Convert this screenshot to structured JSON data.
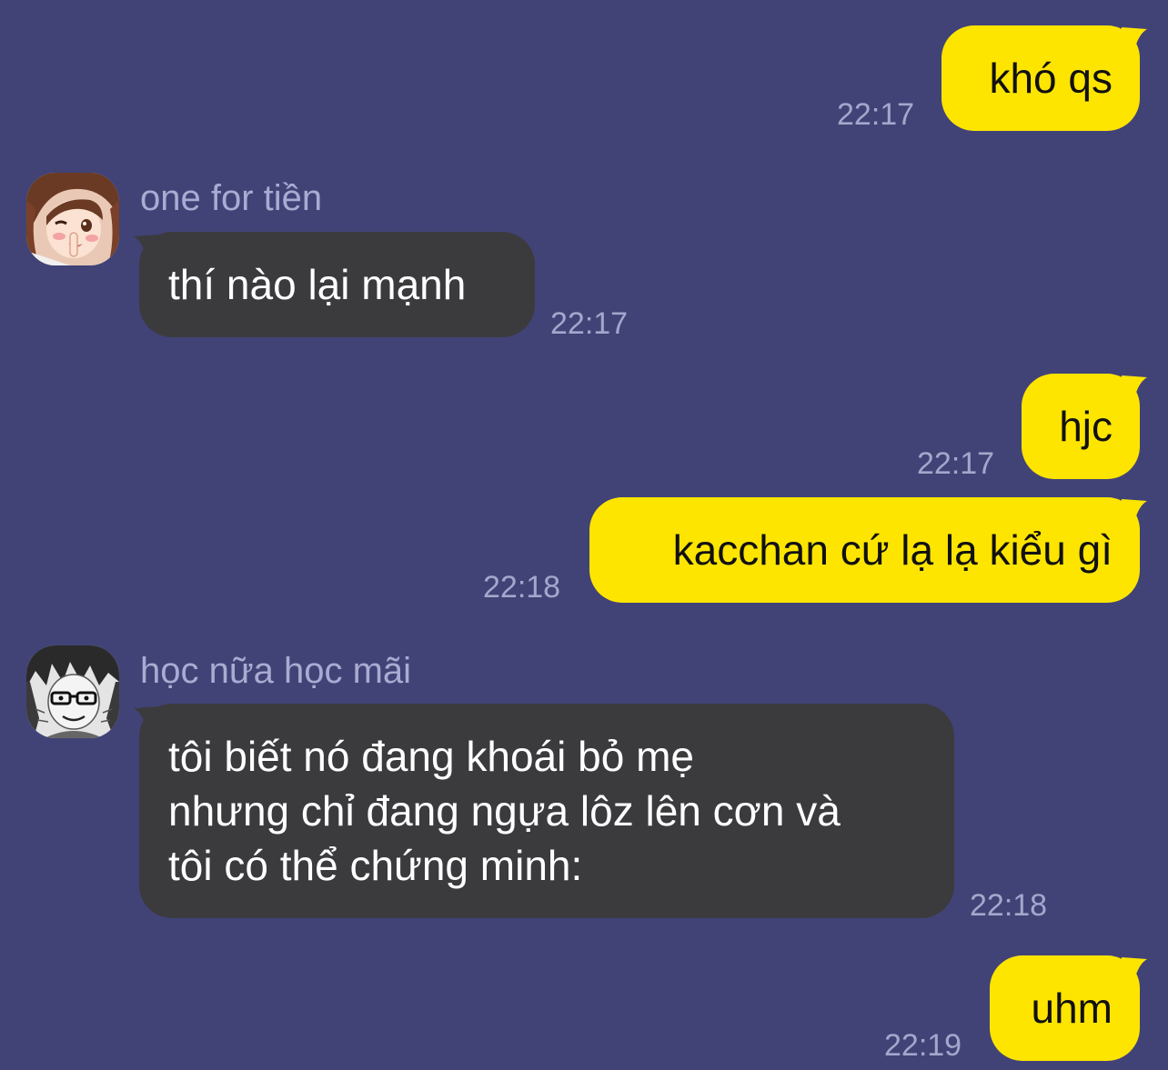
{
  "messages": [
    {
      "direction": "out",
      "text": "khó qs",
      "time": "22:17"
    },
    {
      "direction": "in",
      "sender": "one for tiền",
      "avatar": "anime-girl-avatar",
      "text": "thí nào lại mạnh",
      "time": "22:17"
    },
    {
      "direction": "out",
      "text": "hjc",
      "time": "22:17"
    },
    {
      "direction": "out",
      "text": "kacchan cứ lạ lạ kiểu gì",
      "time": "22:18"
    },
    {
      "direction": "in",
      "sender": "học nữa học mãi",
      "avatar": "manga-character-avatar",
      "lines": [
        "tôi biết nó đang khoái bỏ mẹ",
        "nhưng chỉ đang ngựa lôz lên cơn và",
        "tôi có thể chứng minh:"
      ],
      "time": "22:18"
    },
    {
      "direction": "out",
      "text": "uhm",
      "time": "22:19"
    }
  ],
  "colors": {
    "background": "#414377",
    "outgoing_bubble": "#fee500",
    "incoming_bubble": "#3b3b3e",
    "timestamp": "#a4a6cb",
    "sender_name": "#a9abd2"
  }
}
